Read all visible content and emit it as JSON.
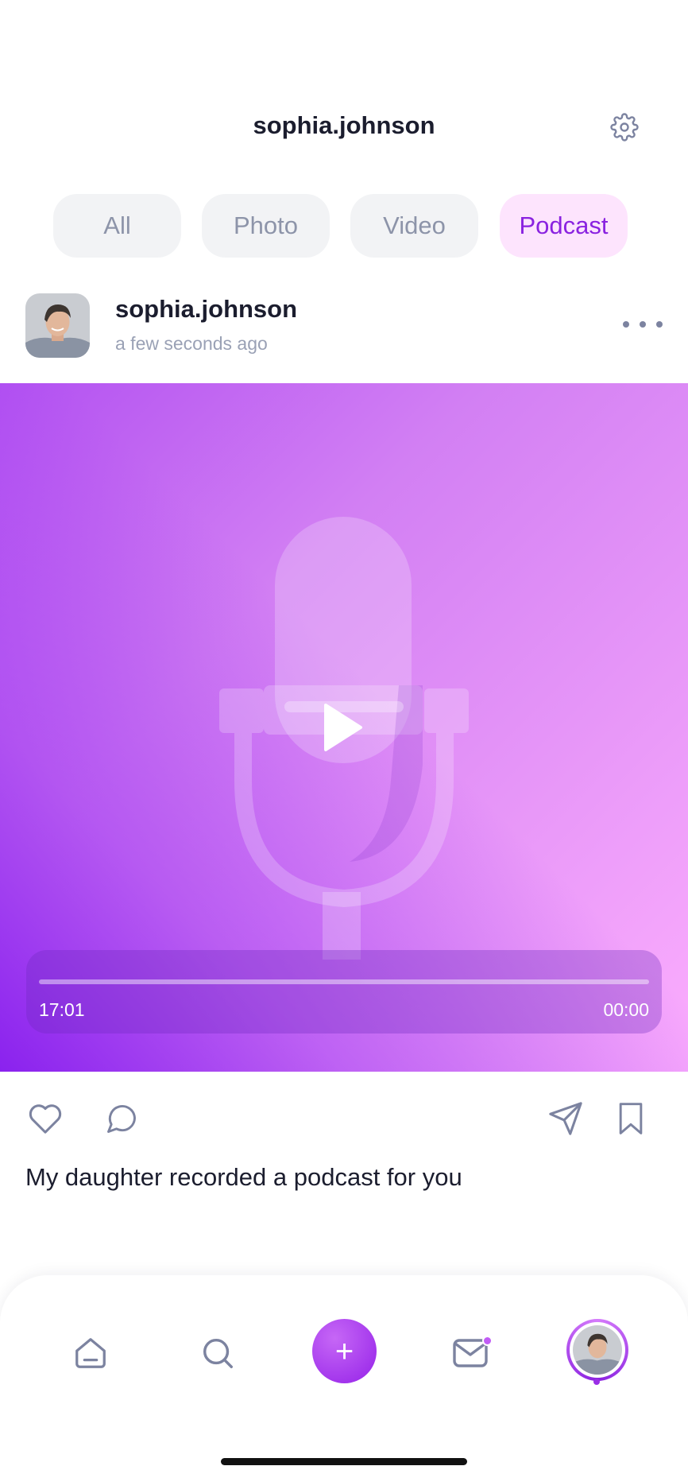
{
  "header": {
    "title": "sophia.johnson",
    "settings_icon": "gear-icon"
  },
  "tabs": [
    {
      "label": "All",
      "active": false
    },
    {
      "label": "Photo",
      "active": false
    },
    {
      "label": "Video",
      "active": false
    },
    {
      "label": "Podcast",
      "active": true
    }
  ],
  "post": {
    "username": "sophia.johnson",
    "time": "a few seconds ago",
    "media_type": "podcast",
    "player": {
      "elapsed": "17:01",
      "remaining": "00:00",
      "progress": 0
    },
    "caption": "My daughter recorded a podcast for you",
    "actions": [
      "heart-icon",
      "comment-icon",
      "send-icon",
      "bookmark-icon"
    ]
  },
  "bottom_nav": {
    "items": [
      "home-icon",
      "search-icon",
      "plus-icon",
      "mail-icon",
      "profile-avatar"
    ],
    "plus_label": "+",
    "mail_has_badge": true,
    "active": "profile-avatar"
  },
  "colors": {
    "accent": "#8a22e0",
    "tab_active_bg": "#fde4fd",
    "tab_bg": "#f2f3f5",
    "text_primary": "#1b1d2e",
    "text_secondary": "#9aa1b5",
    "gradient_start": "#8a22ee",
    "gradient_end": "#fbadfd"
  }
}
